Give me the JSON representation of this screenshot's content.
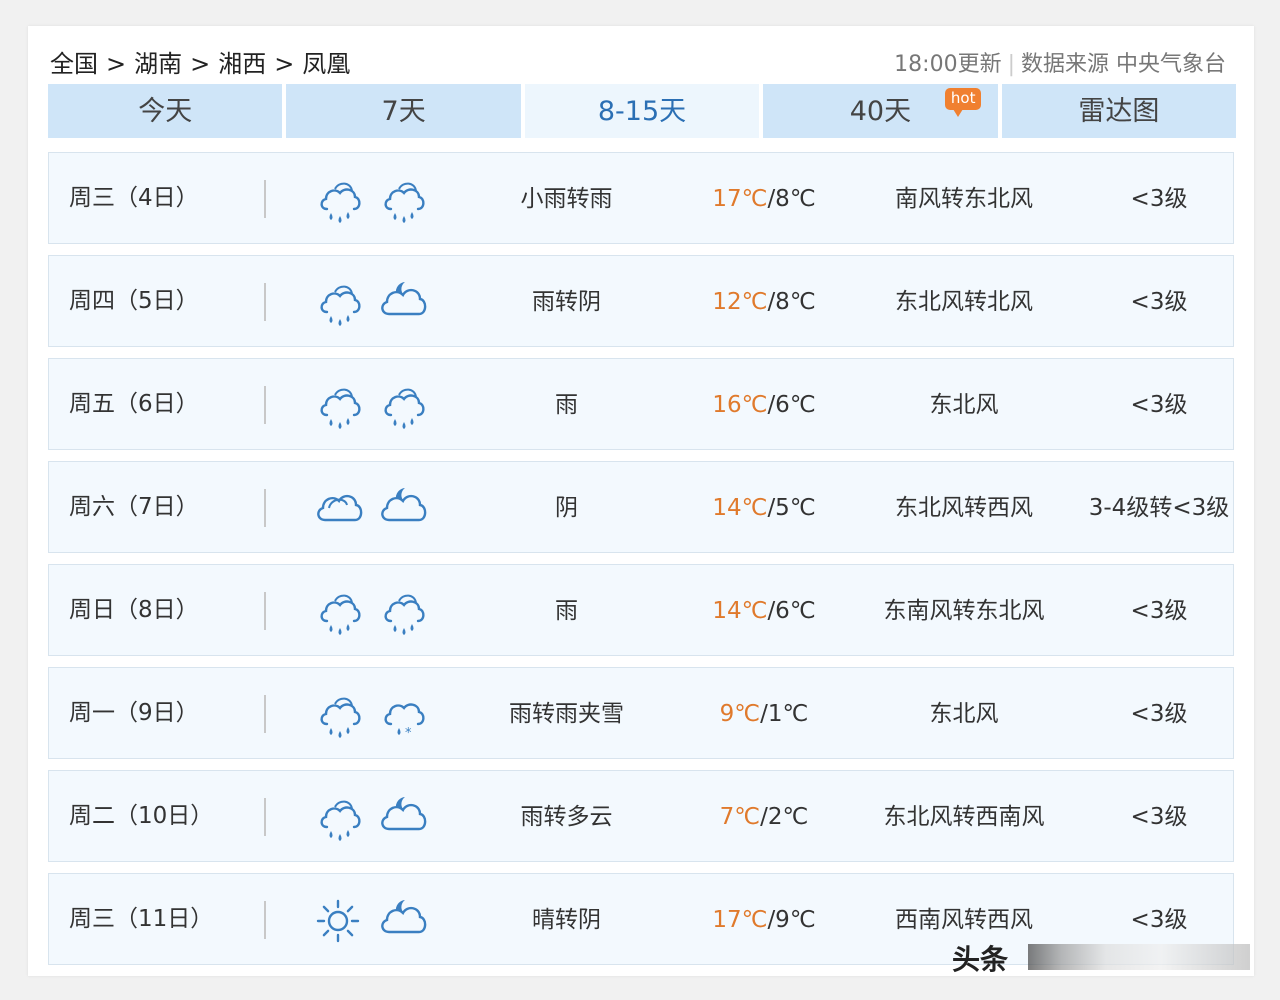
{
  "breadcrumb": [
    "全国",
    "湖南",
    "湘西",
    "凤凰"
  ],
  "breadcrumb_sep": ">",
  "update": "18:00更新",
  "source": "数据来源 中央气象台",
  "tabs": [
    {
      "label": "今天",
      "active": false
    },
    {
      "label": "7天",
      "active": false
    },
    {
      "label": "8-15天",
      "active": true
    },
    {
      "label": "40天",
      "active": false,
      "badge": "hot"
    },
    {
      "label": "雷达图",
      "active": false
    }
  ],
  "days": [
    {
      "day": "周三（4日）",
      "icons": [
        "cloud-rain-icon",
        "cloud-rain-icon"
      ],
      "weather": "小雨转雨",
      "high": "17℃",
      "low": "/8℃",
      "wind": "南风转东北风",
      "level": "<3级"
    },
    {
      "day": "周四（5日）",
      "icons": [
        "cloud-rain-icon",
        "moon-cloud-icon"
      ],
      "weather": "雨转阴",
      "high": "12℃",
      "low": "/8℃",
      "wind": "东北风转北风",
      "level": "<3级"
    },
    {
      "day": "周五（6日）",
      "icons": [
        "cloud-rain-icon",
        "cloud-rain-icon"
      ],
      "weather": "雨",
      "high": "16℃",
      "low": "/6℃",
      "wind": "东北风",
      "level": "<3级"
    },
    {
      "day": "周六（7日）",
      "icons": [
        "overcast-icon",
        "moon-cloud-icon"
      ],
      "weather": "阴",
      "high": "14℃",
      "low": "/5℃",
      "wind": "东北风转西风",
      "level": "3-4级转<3级"
    },
    {
      "day": "周日（8日）",
      "icons": [
        "cloud-rain-icon",
        "cloud-rain-icon"
      ],
      "weather": "雨",
      "high": "14℃",
      "low": "/6℃",
      "wind": "东南风转东北风",
      "level": "<3级"
    },
    {
      "day": "周一（9日）",
      "icons": [
        "cloud-rain-icon",
        "sleet-icon"
      ],
      "weather": "雨转雨夹雪",
      "high": "9℃",
      "low": "/1℃",
      "wind": "东北风",
      "level": "<3级"
    },
    {
      "day": "周二（10日）",
      "icons": [
        "cloud-rain-icon",
        "moon-cloud-icon"
      ],
      "weather": "雨转多云",
      "high": "7℃",
      "low": "/2℃",
      "wind": "东北风转西南风",
      "level": "<3级"
    },
    {
      "day": "周三（11日）",
      "icons": [
        "sun-icon",
        "moon-cloud-icon"
      ],
      "weather": "晴转阴",
      "high": "17℃",
      "low": "/9℃",
      "wind": "西南风转西风",
      "level": "<3级"
    }
  ],
  "colors": {
    "tab": "#cfe5f8",
    "tab_active": "#edf6fd",
    "tab_active_text": "#2b6fb4",
    "high_temp": "#e07a2c",
    "icon": "#3a7fc1",
    "hot": "#f08030"
  },
  "watermark": "头条"
}
